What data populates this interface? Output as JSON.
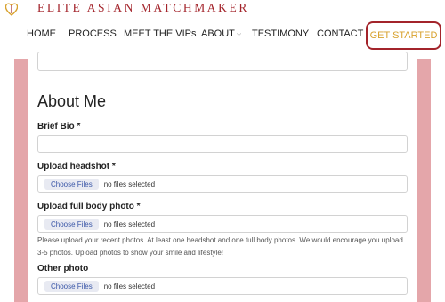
{
  "brand": {
    "name": "ELITE ASIAN MATCHMAKER"
  },
  "nav": {
    "items": [
      "HOME",
      "PROCESS",
      "MEET THE VIPs",
      "ABOUT",
      "TESTIMONY",
      "CONTACT"
    ],
    "cta_label": "GET STARTED"
  },
  "form": {
    "section_title": "About Me",
    "brief_bio_label": "Brief Bio *",
    "brief_bio_value": "",
    "headshot_label": "Upload headshot *",
    "full_body_label": "Upload full body photo *",
    "other_photo_label": "Other photo",
    "choose_files": "Choose Files",
    "no_files": "no files selected",
    "help_text": "Please upload your recent photos. At least one headshot and one full body photos. We would encourage you upload 3-5 photos. Upload photos to show your smile and lifestyle!"
  },
  "colors": {
    "brand": "#a3242b",
    "cta_text": "#d8a22e",
    "side_band": "#e4a6aa",
    "file_button": "#3a57a8"
  }
}
